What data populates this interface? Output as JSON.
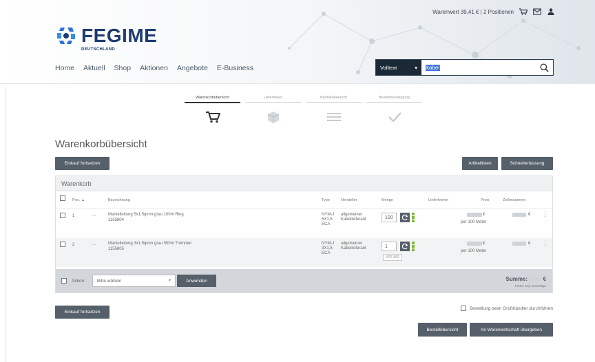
{
  "header": {
    "cart_value_label": "Warenwert 39,41 € | 2 Positionen",
    "logo": {
      "name": "FEGIME",
      "sub": "DEUTSCHLAND"
    },
    "nav": [
      "Home",
      "Aktuell",
      "Shop",
      "Aktionen",
      "Angebote",
      "E-Business"
    ],
    "search": {
      "mode": "Volltext",
      "value": "kabel"
    }
  },
  "steps": [
    {
      "label": "Warenkorbübersicht",
      "icon": "cart-icon",
      "active": true
    },
    {
      "label": "Lieferdaten",
      "icon": "box-icon",
      "active": false
    },
    {
      "label": "Bestellübersicht",
      "icon": "list-icon",
      "active": false
    },
    {
      "label": "Bestellbestätigung",
      "icon": "check-icon",
      "active": false
    }
  ],
  "page_title": "Warenkorbübersicht",
  "buttons": {
    "continue_shopping": "Einkauf fortsetzen",
    "article_list": "Artikellisten",
    "quick_entry": "Schnellerfassung",
    "apply": "Anwenden",
    "order_overview": "Bestellübersicht",
    "to_basket_transfer": "An Warenwirtschaft übergeben"
  },
  "cart": {
    "heading": "Warenkorb",
    "columns": {
      "pos": "Pos.",
      "description": "Bezeichnung",
      "type": "Type",
      "manufacturer": "Hersteller",
      "quantity": "Menge",
      "delivery_date": "Liefertermin",
      "price": "Preis",
      "line_total": "Zeilensumme"
    },
    "rows": [
      {
        "pos": "1",
        "description": "Mantelleitung 5x1,5qmm grau 100m Ring",
        "article_no": "1155804",
        "type": "NYM-J 5X1,5 ECA",
        "manufacturer": "allgemeiner Kabellieferant",
        "quantity": "100",
        "price_unit": "per 100 Meter"
      },
      {
        "pos": "2",
        "description": "Mantelleitung 3x1,5qmm grau 500m Trommel",
        "article_no": "1155805",
        "type": "NYM-J 3X1,5 ECA",
        "manufacturer": "allgemeiner Kabellieferant",
        "quantity": "1",
        "vpe": "VPE 500",
        "price_unit": "per 100 Meter"
      }
    ],
    "footer": {
      "action_label": "Aktion:",
      "select_placeholder": "Bitte wählen",
      "sum_label": "Summe:",
      "sum_sub": "Preise zzgl. Zuschläge"
    }
  },
  "confirm_label": "Bestellung beim Großhändler durchführen"
}
